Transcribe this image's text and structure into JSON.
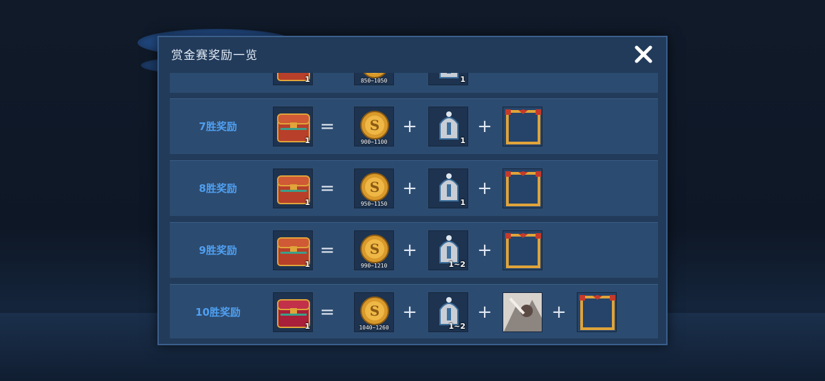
{
  "dialog": {
    "title": "赏金赛奖励一览",
    "close_label": "✕"
  },
  "operators": {
    "equals": "=",
    "plus": "+"
  },
  "partial_row": {
    "chest_qty": "1",
    "coin_range": "850~1050",
    "helmet_qty": "1"
  },
  "rows": [
    {
      "label": "7胜奖励",
      "chest_qty": "1",
      "coin_range": "900~1100",
      "helmet_qty": "1",
      "has_skin": false
    },
    {
      "label": "8胜奖励",
      "chest_qty": "1",
      "coin_range": "950~1150",
      "helmet_qty": "1",
      "has_skin": false
    },
    {
      "label": "9胜奖励",
      "chest_qty": "1",
      "coin_range": "990~1210",
      "helmet_qty": "1~2",
      "has_skin": false
    },
    {
      "label": "10胜奖励",
      "chest_qty": "1",
      "coin_range": "1040~1260",
      "helmet_qty": "1~2",
      "has_skin": true
    }
  ],
  "colors": {
    "row_label": "#4f9ff0",
    "dialog_bg": "#223b5a",
    "row_bg": "#2c4b70",
    "gold": "#e0a43a"
  },
  "icons": [
    "treasure-chest-icon",
    "gold-coin-icon",
    "helmet-icon",
    "avatar-frame-icon",
    "hero-skin-icon",
    "close-icon"
  ]
}
